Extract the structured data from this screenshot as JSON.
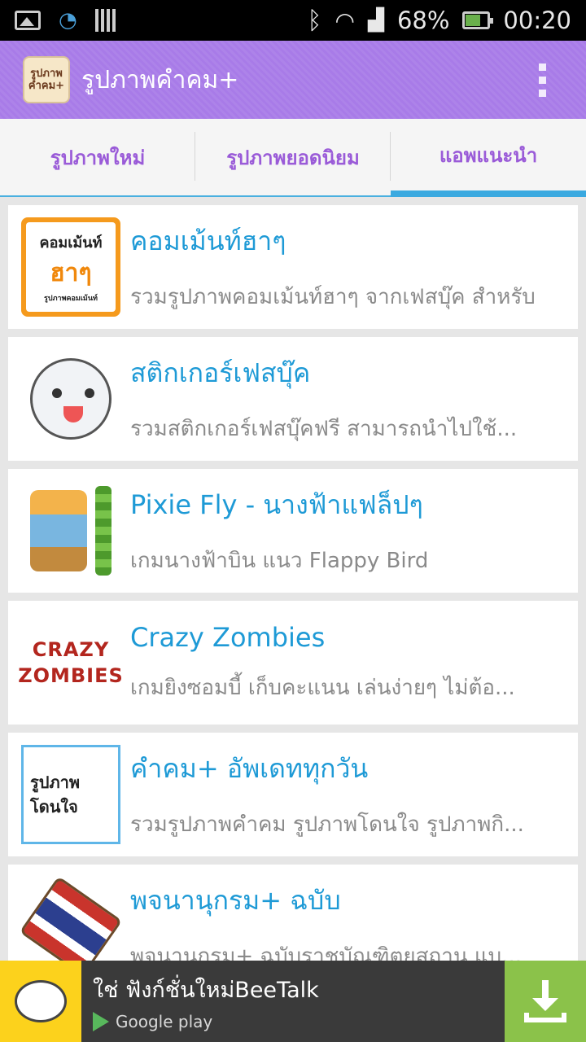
{
  "status_bar": {
    "battery": "68%",
    "time": "00:20",
    "icons": [
      "image-icon",
      "wifi-icon",
      "barcode-icon",
      "bluetooth-icon",
      "wifi-signal-icon",
      "cell-signal-icon",
      "battery-charging-icon"
    ]
  },
  "action_bar": {
    "app_icon_text_1": "รูปภาพ",
    "app_icon_text_2": "คำคม+",
    "title": "รูปภาพคำคม+"
  },
  "tabs": [
    {
      "label": "รูปภาพใหม่",
      "active": false
    },
    {
      "label": "รูปภาพยอดนิยม",
      "active": false
    },
    {
      "label": "แอพแนะนำ",
      "active": true
    }
  ],
  "apps": [
    {
      "title": "คอมเม้นท์ฮาๆ",
      "desc": "รวมรูปภาพคอมเม้นท์ฮาๆ จากเฟสบุ๊ค สำหรับ",
      "thumb_text_1": "คอมเม้นท์",
      "thumb_text_2": "ฮาๆ",
      "thumb_text_3": "รูปภาพคอมเม้นท์"
    },
    {
      "title": "สติกเกอร์เฟสบุ๊ค",
      "desc": "รวมสติกเกอร์เฟสบุ๊คฟรี สามารถนำไปใช้..."
    },
    {
      "title": "Pixie Fly - นางฟ้าแฟล็ปๆ",
      "desc": "เกมนางฟ้าบิน แนว Flappy Bird"
    },
    {
      "title": "Crazy Zombies",
      "desc": "เกมยิงซอมบี้ เก็บคะแนน เล่นง่ายๆ ไม่ต้อ...",
      "thumb_text_1": "CRAZY",
      "thumb_text_2": "ZOMBIES"
    },
    {
      "title": "คำคม+ อัพเดททุกวัน",
      "desc": "รวมรูปภาพคำคม รูปภาพโดนใจ รูปภาพกิ...",
      "thumb_text_1": "รูปภาพ",
      "thumb_text_2": "โดนใจ"
    },
    {
      "title": "พจนานุกรม+ ฉบับ",
      "desc": "พจนานุกรม+ ฉบับราชบัณฑิตยสถาน แบ..."
    }
  ],
  "ad": {
    "title": "ใช่ ฟังก์ชั่นใหม่BeeTalk",
    "store": "Google play"
  }
}
